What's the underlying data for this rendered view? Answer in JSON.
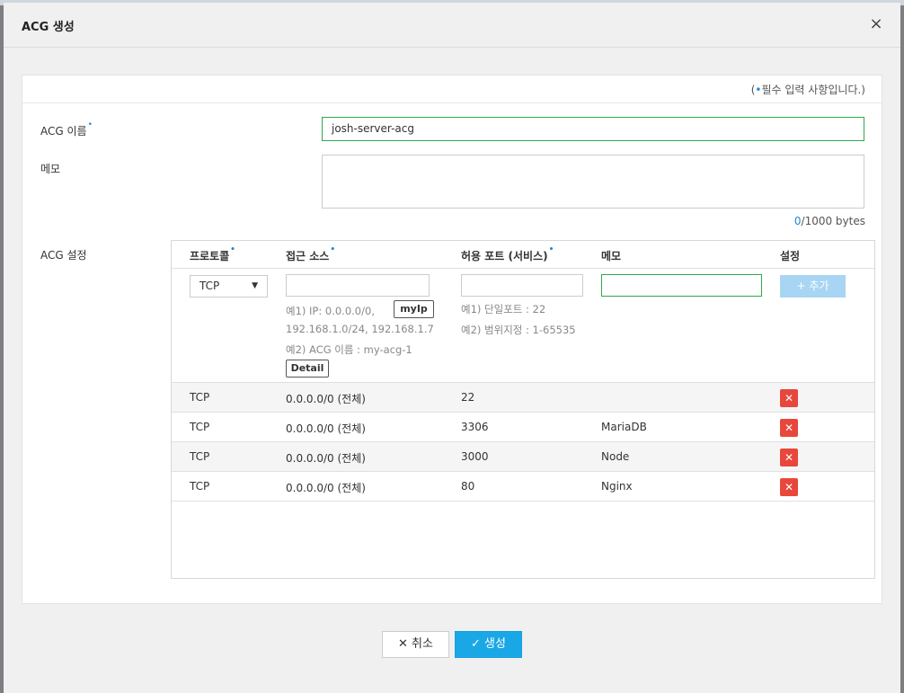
{
  "modal": {
    "title": "ACG 생성",
    "close_glyph": "×"
  },
  "required_note": {
    "open": "(",
    "dot": "•",
    "text": "필수 입력 사항입니다.)"
  },
  "form": {
    "name_label": "ACG 이름",
    "name_value": "josh-server-acg",
    "memo_label": "메모",
    "memo_value": "",
    "byte_count_used": "0",
    "byte_count_rest": "/1000 bytes",
    "settings_label": "ACG 설정"
  },
  "rules": {
    "headers": {
      "protocol": "프로토콜",
      "source": "접근 소스",
      "port": "허용 포트 (서비스)",
      "memo": "메모",
      "settings": "설정"
    },
    "protocol_selected": "TCP",
    "caret": "▼",
    "source_hint1_line1": "예1) IP: 0.0.0.0/0,",
    "source_hint1_line2": "192.168.1.0/24, 192.168.1.7",
    "source_hint2": "예2) ACG 이름 : my-acg-1",
    "myip_button": "myIp",
    "detail_button": "Detail",
    "port_hint1": "예1) 단일포트 : 22",
    "port_hint2": "예2) 범위지정 : 1-65535",
    "add_button": "+ 추가",
    "delete_glyph": "✕",
    "items": [
      {
        "protocol": "TCP",
        "source": "0.0.0.0/0 (전체)",
        "port": "22",
        "memo": ""
      },
      {
        "protocol": "TCP",
        "source": "0.0.0.0/0 (전체)",
        "port": "3306",
        "memo": "MariaDB"
      },
      {
        "protocol": "TCP",
        "source": "0.0.0.0/0 (전체)",
        "port": "3000",
        "memo": "Node"
      },
      {
        "protocol": "TCP",
        "source": "0.0.0.0/0 (전체)",
        "port": "80",
        "memo": "Nginx"
      }
    ]
  },
  "footer": {
    "cancel_label": "✕ 취소",
    "create_label": "✓ 생성"
  },
  "colors": {
    "accent": "#1aa7e6",
    "required_dot": "#1e88d6",
    "delete": "#e8473c",
    "valid_border": "#2fa84f",
    "add_disabled": "#a8d5f3"
  },
  "icons": {
    "close": "close-icon",
    "caret": "caret-down-icon",
    "delete": "delete-x-icon",
    "cancel": "x-icon",
    "create": "check-icon",
    "add": "plus-icon"
  }
}
